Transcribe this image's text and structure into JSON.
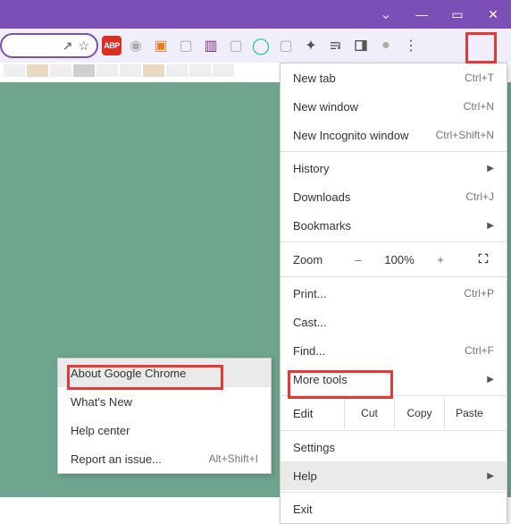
{
  "window": {
    "tab_dropdown": "⌄",
    "minimize": "—",
    "maximize": "▭",
    "close": "✕"
  },
  "toolbar": {
    "share_icon": "↗",
    "star_icon": "☆",
    "abp_label": "ABP",
    "kebab": "⋮"
  },
  "main_menu": {
    "new_tab": "New tab",
    "new_tab_accel": "Ctrl+T",
    "new_window": "New window",
    "new_window_accel": "Ctrl+N",
    "new_incognito": "New Incognito window",
    "new_incognito_accel": "Ctrl+Shift+N",
    "history": "History",
    "downloads": "Downloads",
    "downloads_accel": "Ctrl+J",
    "bookmarks": "Bookmarks",
    "zoom_label": "Zoom",
    "zoom_minus": "–",
    "zoom_value": "100%",
    "zoom_plus": "+",
    "print": "Print...",
    "print_accel": "Ctrl+P",
    "cast": "Cast...",
    "find": "Find...",
    "find_accel": "Ctrl+F",
    "more_tools": "More tools",
    "edit_label": "Edit",
    "cut": "Cut",
    "copy": "Copy",
    "paste": "Paste",
    "settings": "Settings",
    "help": "Help",
    "exit": "Exit",
    "arrow": "▶"
  },
  "help_menu": {
    "about": "About Google Chrome",
    "whats_new": "What's New",
    "help_center": "Help center",
    "report": "Report an issue...",
    "report_accel": "Alt+Shift+I"
  }
}
